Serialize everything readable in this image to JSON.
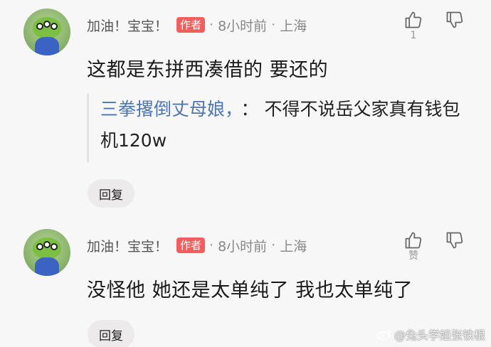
{
  "comments": [
    {
      "author": "加油！宝宝！",
      "badge": "作者",
      "time": "8小时前",
      "location": "上海",
      "like_count": "1",
      "text": "这都是东拼西凑借的 要还的",
      "quote": {
        "name": "三拳撂倒丈母娘，",
        "separator": "：",
        "text": "不得不说岳父家真有钱包机120w"
      },
      "reply_label": "回复"
    },
    {
      "author": "加油！宝宝！",
      "badge": "作者",
      "time": "8小时前",
      "location": "上海",
      "like_label": "赞",
      "text": "没怪他 她还是太单纯了 我也太单纯了",
      "reply_label": "回复"
    }
  ],
  "watermark": "@兔头学姐张铁根",
  "icons": {
    "like": "thumbs-up-icon",
    "dislike": "thumbs-down-icon",
    "weibo": "weibo-icon"
  },
  "colors": {
    "badge": "#f25d5d",
    "quote_name": "#4d76b0",
    "background": "#f7f7f7"
  }
}
